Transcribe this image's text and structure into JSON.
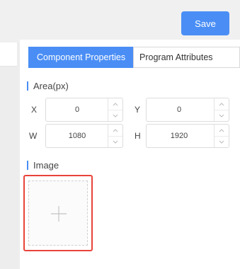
{
  "toolbar": {
    "save_label": "Save"
  },
  "tabs": [
    {
      "label": "Component Properties",
      "active": true
    },
    {
      "label": "Program Attributes",
      "active": false
    }
  ],
  "area": {
    "title": "Area(px)",
    "fields": [
      {
        "label": "X",
        "value": "0"
      },
      {
        "label": "Y",
        "value": "0"
      },
      {
        "label": "W",
        "value": "1080"
      },
      {
        "label": "H",
        "value": "1920"
      }
    ]
  },
  "image": {
    "title": "Image"
  },
  "icons": {
    "step_up": "chevron-up-icon",
    "step_down": "chevron-down-icon",
    "upload": "plus-icon"
  },
  "colors": {
    "accent": "#4a8ef5",
    "highlight": "#e8433a"
  }
}
